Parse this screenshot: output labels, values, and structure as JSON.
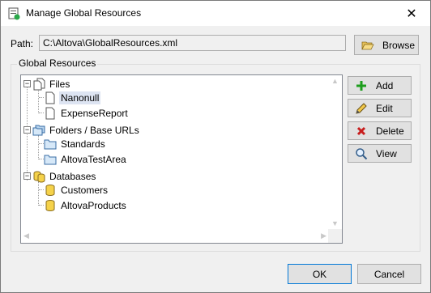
{
  "window": {
    "title": "Manage Global Resources",
    "close_glyph": "✕"
  },
  "path": {
    "label": "Path:",
    "value": "C:\\Altova\\GlobalResources.xml",
    "browse_label": "Browse",
    "browse_icon": "folder-open-icon"
  },
  "group": {
    "title": "Global Resources"
  },
  "tree": [
    {
      "label": "Files",
      "type": "category",
      "icon": "files-icon",
      "expanded": true
    },
    {
      "label": "Nanonull",
      "type": "file",
      "icon": "file-icon",
      "selected": true
    },
    {
      "label": "ExpenseReport",
      "type": "file",
      "icon": "file-icon"
    },
    {
      "label": "Folders / Base URLs",
      "type": "category",
      "icon": "folders-icon",
      "expanded": true
    },
    {
      "label": "Standards",
      "type": "folder",
      "icon": "folder-icon"
    },
    {
      "label": "AltovaTestArea",
      "type": "folder",
      "icon": "folder-icon"
    },
    {
      "label": "Databases",
      "type": "category",
      "icon": "databases-icon",
      "expanded": true
    },
    {
      "label": "Customers",
      "type": "database",
      "icon": "database-icon"
    },
    {
      "label": "AltovaProducts",
      "type": "database",
      "icon": "database-icon"
    }
  ],
  "actions": {
    "add": "Add",
    "edit": "Edit",
    "delete": "Delete",
    "view": "View"
  },
  "footer": {
    "ok": "OK",
    "cancel": "Cancel"
  },
  "colors": {
    "accent": "#0078d7",
    "selection": "#dde4f2",
    "add_green": "#1e9e1e",
    "delete_red": "#c81e1e"
  }
}
